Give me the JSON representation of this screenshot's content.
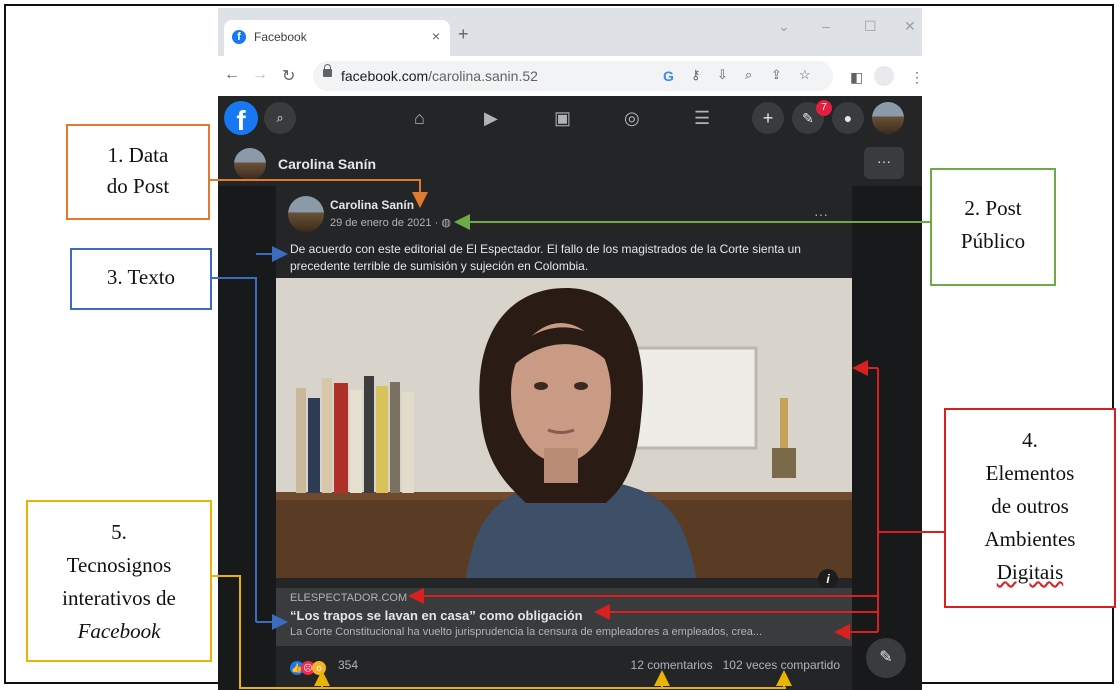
{
  "browser": {
    "tab_title": "Facebook",
    "tab_close": "×",
    "new_tab": "+",
    "url_host": "facebook.com",
    "url_path": "/carolina.sanin.52"
  },
  "facebook": {
    "messenger_badge": "7",
    "profile_name": "Carolina Sanín",
    "more_label": "···"
  },
  "post": {
    "author": "Carolina Sanín",
    "date": "29 de enero de 2021 · ",
    "privacy": "public-globe-icon",
    "text": "De acuerdo con este editorial de El Espectador. El fallo de los magistrados de la Corte sienta un precedente terrible de sumisión y sujeción en Colombia.",
    "options": "···",
    "link_domain": "ELESPECTADOR.COM",
    "link_title": "“Los trapos se lavan en casa” como obligación",
    "link_description": "La Corte Constitucional ha vuelto jurisprudencia la censura de empleadores a empleados, crea...",
    "reaction_count": "354",
    "comments": "12 comentarios",
    "shares": "102 veces compartido"
  },
  "annotations": {
    "a1_line1": "1. Data",
    "a1_line2": "do Post",
    "a2_line1": "2. Post",
    "a2_line2": "Público",
    "a3": "3. Texto",
    "a4_line1": "4.",
    "a4_line2": "Elementos",
    "a4_line3": "de outros",
    "a4_line4": "Ambientes",
    "a4_line5": "Digitais",
    "a5_line1": "5.",
    "a5_line2": "Tecnosignos",
    "a5_line3": "interativos de",
    "a5_line4": "Facebook"
  },
  "colors": {
    "orange": "#e07a2e",
    "green": "#6cab45",
    "blue": "#3c6cc0",
    "red": "#d92020",
    "yellow": "#e8b400",
    "fb_blue": "#1877f2"
  }
}
